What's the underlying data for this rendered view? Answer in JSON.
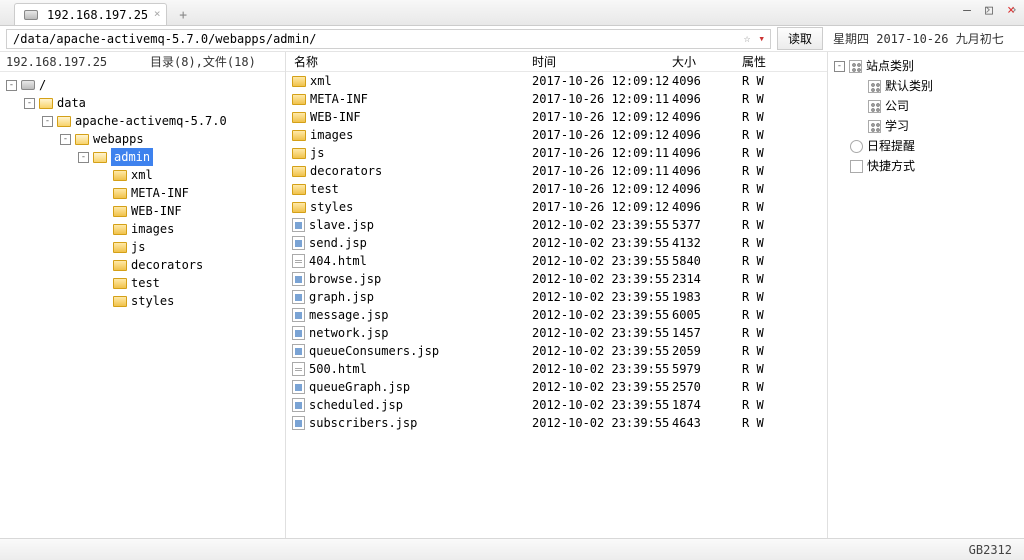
{
  "tab": {
    "ip": "192.168.197.25"
  },
  "path": "/data/apache-activemq-5.7.0/webapps/admin/",
  "read_btn": "读取",
  "date_info": "星期四 2017-10-26 九月初七",
  "tree_header": {
    "ip": "192.168.197.25",
    "summary": "目录(8),文件(18)"
  },
  "tree": {
    "root": "/",
    "data": "data",
    "amq": "apache-activemq-5.7.0",
    "webapps": "webapps",
    "admin": "admin",
    "children": [
      "xml",
      "META-INF",
      "WEB-INF",
      "images",
      "js",
      "decorators",
      "test",
      "styles"
    ]
  },
  "col": {
    "name": "名称",
    "time": "时间",
    "size": "大小",
    "attr": "属性"
  },
  "files": [
    {
      "n": "xml",
      "t": "2017-10-26 12:09:12",
      "s": "4096",
      "a": "R W",
      "k": "dir"
    },
    {
      "n": "META-INF",
      "t": "2017-10-26 12:09:11",
      "s": "4096",
      "a": "R W",
      "k": "dir"
    },
    {
      "n": "WEB-INF",
      "t": "2017-10-26 12:09:12",
      "s": "4096",
      "a": "R W",
      "k": "dir"
    },
    {
      "n": "images",
      "t": "2017-10-26 12:09:12",
      "s": "4096",
      "a": "R W",
      "k": "dir"
    },
    {
      "n": "js",
      "t": "2017-10-26 12:09:11",
      "s": "4096",
      "a": "R W",
      "k": "dir"
    },
    {
      "n": "decorators",
      "t": "2017-10-26 12:09:11",
      "s": "4096",
      "a": "R W",
      "k": "dir"
    },
    {
      "n": "test",
      "t": "2017-10-26 12:09:12",
      "s": "4096",
      "a": "R W",
      "k": "dir"
    },
    {
      "n": "styles",
      "t": "2017-10-26 12:09:12",
      "s": "4096",
      "a": "R W",
      "k": "dir"
    },
    {
      "n": "slave.jsp",
      "t": "2012-10-02 23:39:55",
      "s": "5377",
      "a": "R W",
      "k": "jsp"
    },
    {
      "n": "send.jsp",
      "t": "2012-10-02 23:39:55",
      "s": "4132",
      "a": "R W",
      "k": "jsp"
    },
    {
      "n": "404.html",
      "t": "2012-10-02 23:39:55",
      "s": "5840",
      "a": "R W",
      "k": "html"
    },
    {
      "n": "browse.jsp",
      "t": "2012-10-02 23:39:55",
      "s": "2314",
      "a": "R W",
      "k": "jsp"
    },
    {
      "n": "graph.jsp",
      "t": "2012-10-02 23:39:55",
      "s": "1983",
      "a": "R W",
      "k": "jsp"
    },
    {
      "n": "message.jsp",
      "t": "2012-10-02 23:39:55",
      "s": "6005",
      "a": "R W",
      "k": "jsp"
    },
    {
      "n": "network.jsp",
      "t": "2012-10-02 23:39:55",
      "s": "1457",
      "a": "R W",
      "k": "jsp"
    },
    {
      "n": "queueConsumers.jsp",
      "t": "2012-10-02 23:39:55",
      "s": "2059",
      "a": "R W",
      "k": "jsp"
    },
    {
      "n": "500.html",
      "t": "2012-10-02 23:39:55",
      "s": "5979",
      "a": "R W",
      "k": "html"
    },
    {
      "n": "queueGraph.jsp",
      "t": "2012-10-02 23:39:55",
      "s": "2570",
      "a": "R W",
      "k": "jsp"
    },
    {
      "n": "scheduled.jsp",
      "t": "2012-10-02 23:39:55",
      "s": "1874",
      "a": "R W",
      "k": "jsp"
    },
    {
      "n": "subscribers.jsp",
      "t": "2012-10-02 23:39:55",
      "s": "4643",
      "a": "R W",
      "k": "jsp"
    }
  ],
  "side": {
    "site": "站点类别",
    "default": "默认类别",
    "company": "公司",
    "study": "学习",
    "reminder": "日程提醒",
    "shortcut": "快捷方式"
  },
  "encoding": "GB2312"
}
